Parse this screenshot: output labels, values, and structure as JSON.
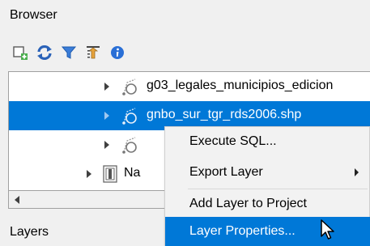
{
  "panel": {
    "title": "Browser"
  },
  "toolbar": {
    "buttons": [
      "add-layer-icon",
      "refresh-icon",
      "filter-icon",
      "collapse-all-icon",
      "info-icon"
    ]
  },
  "tree": {
    "rows": [
      {
        "label": "g03_legales_municipios_edicion"
      },
      {
        "label": "gnbo_sur_tgr_rds2006.shp"
      },
      {
        "label": ""
      },
      {
        "label": "Na"
      }
    ]
  },
  "context_menu": {
    "items": [
      {
        "label": "Execute SQL..."
      },
      {
        "label": "Export Layer"
      },
      {
        "label": "Add Layer to Project"
      },
      {
        "label": "Layer Properties..."
      }
    ]
  },
  "layers_panel": {
    "title": "Layers"
  },
  "colors": {
    "selection": "#0078d7",
    "panel_bg": "#f0f0f0"
  }
}
